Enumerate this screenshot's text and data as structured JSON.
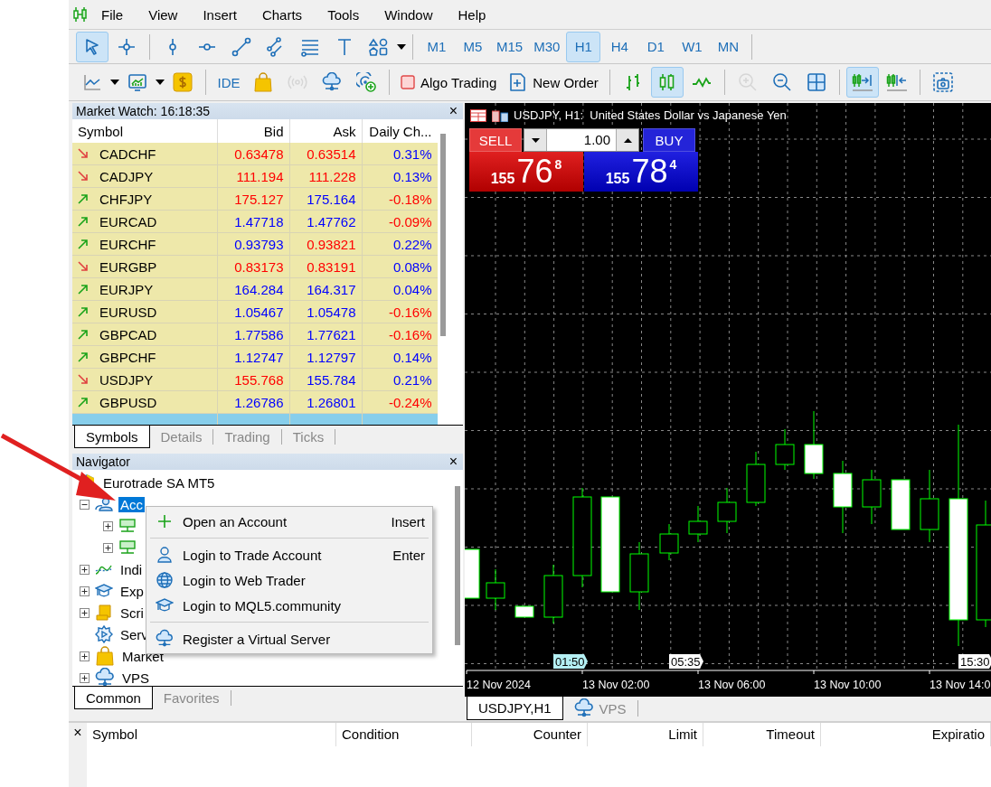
{
  "menu": [
    "File",
    "View",
    "Insert",
    "Charts",
    "Tools",
    "Window",
    "Help"
  ],
  "toolbar1": {
    "tools": [
      {
        "kind": "pointer",
        "selected": true
      },
      {
        "kind": "crosshair",
        "selected": false
      },
      {
        "kind": "vline",
        "selected": false
      },
      {
        "kind": "hline",
        "selected": false
      },
      {
        "kind": "trendline",
        "selected": false
      },
      {
        "kind": "channel",
        "selected": false
      },
      {
        "kind": "fibo",
        "selected": false
      },
      {
        "kind": "texttool",
        "selected": false
      },
      {
        "kind": "shapes",
        "selected": false
      }
    ],
    "timeframes": [
      {
        "label": "M1",
        "selected": false
      },
      {
        "label": "M5",
        "selected": false
      },
      {
        "label": "M15",
        "selected": false
      },
      {
        "label": "M30",
        "selected": false
      },
      {
        "label": "H1",
        "selected": true
      },
      {
        "label": "H4",
        "selected": false
      },
      {
        "label": "D1",
        "selected": false
      },
      {
        "label": "W1",
        "selected": false
      },
      {
        "label": "MN",
        "selected": false
      }
    ]
  },
  "toolbar2": [
    {
      "kind": "linechart",
      "selected": false,
      "disabled": false
    },
    {
      "kind": "monitor",
      "selected": false,
      "disabled": false
    },
    {
      "kind": "money",
      "selected": false,
      "disabled": false
    },
    {
      "kind": "sep"
    },
    {
      "kind": "text",
      "label": "IDE",
      "selected": false,
      "disabled": false
    },
    {
      "kind": "bag",
      "selected": false,
      "disabled": false
    },
    {
      "kind": "signal",
      "selected": false,
      "disabled": true
    },
    {
      "kind": "cloud",
      "selected": false,
      "disabled": false
    },
    {
      "kind": "radar",
      "selected": false,
      "disabled": false
    },
    {
      "kind": "sep"
    },
    {
      "kind": "algo",
      "label": "Algo Trading",
      "selected": false,
      "disabled": false
    },
    {
      "kind": "neworder",
      "label": "New Order",
      "selected": false,
      "disabled": false
    },
    {
      "kind": "sep"
    },
    {
      "kind": "bars",
      "selected": false,
      "disabled": false
    },
    {
      "kind": "candles",
      "selected": true,
      "disabled": false
    },
    {
      "kind": "line",
      "selected": false,
      "disabled": false
    },
    {
      "kind": "sep"
    },
    {
      "kind": "zoomin",
      "selected": false,
      "disabled": true
    },
    {
      "kind": "zoomout",
      "selected": false,
      "disabled": false
    },
    {
      "kind": "grid",
      "selected": false,
      "disabled": false
    },
    {
      "kind": "sep"
    },
    {
      "kind": "autoscroll",
      "selected": true,
      "disabled": false
    },
    {
      "kind": "shift",
      "selected": false,
      "disabled": false
    },
    {
      "kind": "sep"
    },
    {
      "kind": "screenshot",
      "selected": false,
      "disabled": false
    }
  ],
  "market_watch": {
    "title": "Market Watch: 16:18:35",
    "close": "×",
    "columns": [
      "Symbol",
      "Bid",
      "Ask",
      "Daily Ch..."
    ],
    "rows": [
      {
        "kind": "down",
        "symbol": "CADCHF",
        "bid": {
          "text": "0.63478",
          "color": "#ff0000"
        },
        "ask": {
          "text": "0.63514",
          "color": "#ff0000"
        },
        "change": {
          "text": "0.31%",
          "color": "#0000ff"
        },
        "selected": false
      },
      {
        "kind": "down",
        "symbol": "CADJPY",
        "bid": {
          "text": "111.194",
          "color": "#ff0000"
        },
        "ask": {
          "text": "111.228",
          "color": "#ff0000"
        },
        "change": {
          "text": "0.13%",
          "color": "#0000ff"
        },
        "selected": false
      },
      {
        "kind": "up",
        "symbol": "CHFJPY",
        "bid": {
          "text": "175.127",
          "color": "#ff0000"
        },
        "ask": {
          "text": "175.164",
          "color": "#0000ff"
        },
        "change": {
          "text": "-0.18%",
          "color": "#ff0000"
        },
        "selected": false
      },
      {
        "kind": "up",
        "symbol": "EURCAD",
        "bid": {
          "text": "1.47718",
          "color": "#0000ff"
        },
        "ask": {
          "text": "1.47762",
          "color": "#0000ff"
        },
        "change": {
          "text": "-0.09%",
          "color": "#ff0000"
        },
        "selected": false
      },
      {
        "kind": "up",
        "symbol": "EURCHF",
        "bid": {
          "text": "0.93793",
          "color": "#0000ff"
        },
        "ask": {
          "text": "0.93821",
          "color": "#ff0000"
        },
        "change": {
          "text": "0.22%",
          "color": "#0000ff"
        },
        "selected": false
      },
      {
        "kind": "down",
        "symbol": "EURGBP",
        "bid": {
          "text": "0.83173",
          "color": "#ff0000"
        },
        "ask": {
          "text": "0.83191",
          "color": "#ff0000"
        },
        "change": {
          "text": "0.08%",
          "color": "#0000ff"
        },
        "selected": false
      },
      {
        "kind": "up",
        "symbol": "EURJPY",
        "bid": {
          "text": "164.284",
          "color": "#0000ff"
        },
        "ask": {
          "text": "164.317",
          "color": "#0000ff"
        },
        "change": {
          "text": "0.04%",
          "color": "#0000ff"
        },
        "selected": false
      },
      {
        "kind": "up",
        "symbol": "EURUSD",
        "bid": {
          "text": "1.05467",
          "color": "#0000ff"
        },
        "ask": {
          "text": "1.05478",
          "color": "#0000ff"
        },
        "change": {
          "text": "-0.16%",
          "color": "#ff0000"
        },
        "selected": false
      },
      {
        "kind": "up",
        "symbol": "GBPCAD",
        "bid": {
          "text": "1.77586",
          "color": "#0000ff"
        },
        "ask": {
          "text": "1.77621",
          "color": "#0000ff"
        },
        "change": {
          "text": "-0.16%",
          "color": "#ff0000"
        },
        "selected": false
      },
      {
        "kind": "up",
        "symbol": "GBPCHF",
        "bid": {
          "text": "1.12747",
          "color": "#0000ff"
        },
        "ask": {
          "text": "1.12797",
          "color": "#0000ff"
        },
        "change": {
          "text": "0.14%",
          "color": "#0000ff"
        },
        "selected": false
      },
      {
        "kind": "down",
        "symbol": "USDJPY",
        "bid": {
          "text": "155.768",
          "color": "#ff0000"
        },
        "ask": {
          "text": "155.784",
          "color": "#0000ff"
        },
        "change": {
          "text": "0.21%",
          "color": "#0000ff"
        },
        "selected": false
      },
      {
        "kind": "up",
        "symbol": "GBPUSD",
        "bid": {
          "text": "1.26786",
          "color": "#0000ff"
        },
        "ask": {
          "text": "1.26801",
          "color": "#0000ff"
        },
        "change": {
          "text": "-0.24%",
          "color": "#ff0000"
        },
        "selected": false
      }
    ],
    "tabs": [
      {
        "label": "Symbols",
        "selected": true
      },
      {
        "label": "Details",
        "selected": false
      },
      {
        "label": "Trading",
        "selected": false
      },
      {
        "label": "Ticks",
        "selected": false
      }
    ]
  },
  "navigator": {
    "title": "Navigator",
    "close": "×",
    "tree": [
      {
        "kind": "broker",
        "label": "Eurotrade SA MT5",
        "selected": false,
        "children": [
          {
            "kind": "accounts",
            "label": "Acc",
            "selected": true,
            "expanded": true,
            "children": [
              {
                "kind": "server",
                "selected": false,
                "expanded": false
              },
              {
                "kind": "server",
                "selected": false,
                "expanded": false
              }
            ]
          },
          {
            "kind": "indicators",
            "label": "Indi",
            "selected": false,
            "expanded": false
          },
          {
            "kind": "experts",
            "label": "Exp",
            "selected": false,
            "expanded": false
          },
          {
            "kind": "scripts",
            "label": "Scri",
            "selected": false,
            "expanded": false
          },
          {
            "kind": "services",
            "label": "Serv",
            "selected": false
          },
          {
            "kind": "market",
            "label": "Market",
            "selected": false,
            "expanded": false
          },
          {
            "kind": "vps",
            "label": "VPS",
            "selected": false,
            "expanded": false
          }
        ]
      }
    ],
    "tabs": [
      {
        "label": "Common",
        "selected": true
      },
      {
        "label": "Favorites",
        "selected": false
      }
    ]
  },
  "context_menu": {
    "groups": [
      [
        {
          "kind": "plus",
          "label": "Open an Account",
          "shortcut": "Insert"
        }
      ],
      [
        {
          "kind": "person",
          "label": "Login to Trade Account",
          "shortcut": "Enter"
        },
        {
          "kind": "globe",
          "label": "Login to Web Trader"
        },
        {
          "kind": "cap",
          "label": "Login to MQL5.community"
        }
      ],
      [
        {
          "kind": "cloud",
          "label": "Register a Virtual Server"
        }
      ]
    ]
  },
  "chart": {
    "title": "USDJPY, H1:  United States Dollar vs Japanese Yen",
    "trade_panel": {
      "sell_label": "SELL",
      "buy_label": "BUY",
      "lot": "1.00",
      "sell": {
        "big": "155",
        "pips": "76",
        "fraction": "8"
      },
      "buy": {
        "big": "155",
        "pips": "78",
        "fraction": "4"
      }
    },
    "markers": [
      {
        "label": "01:50",
        "highlighted": true
      },
      {
        "label": "05:35",
        "highlighted": false
      },
      {
        "label": "15:30",
        "highlighted": false
      }
    ],
    "time_labels": [
      "12 Nov 2024",
      "13 Nov 02:00",
      "13 Nov 06:00",
      "13 Nov 10:00",
      "13 Nov 14:0"
    ],
    "tabs": [
      {
        "label": "USDJPY,H1",
        "selected": true,
        "kind": "chart"
      },
      {
        "label": "VPS",
        "selected": false,
        "kind": "vps"
      }
    ]
  },
  "alerts": {
    "close": "×",
    "columns": [
      "Symbol",
      "Condition",
      "Counter",
      "Limit",
      "Timeout",
      "Expiratio"
    ]
  }
}
